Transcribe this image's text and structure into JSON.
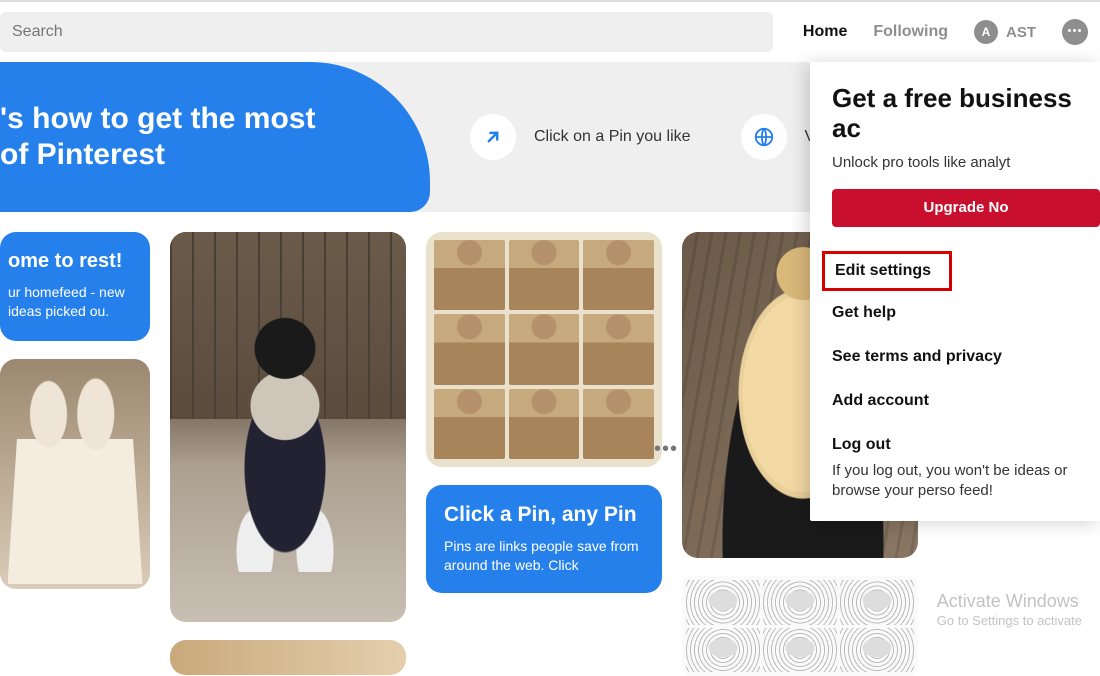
{
  "header": {
    "search_placeholder": "Search",
    "nav": {
      "home": "Home",
      "following": "Following"
    },
    "avatar_initial": "A",
    "user_name": "AST"
  },
  "hero": {
    "title_line1": "'s how to get the most",
    "title_line2": "of Pinterest",
    "tip1": "Click on a Pin you like",
    "tip2": "Visit the link it from"
  },
  "cards": {
    "welcome": {
      "title": "ome to rest!",
      "body": "ur homefeed - new ideas picked ou."
    },
    "clickpin": {
      "title": "Click a Pin, any Pin",
      "body": "Pins are links people save from around the web. Click"
    }
  },
  "dropdown": {
    "title": "Get a free business ac",
    "subtitle": "Unlock pro tools like analyt",
    "button": "Upgrade No",
    "items": {
      "edit": "Edit settings",
      "help": "Get help",
      "terms": "See terms and privacy",
      "add": "Add account",
      "logout": "Log out"
    },
    "logout_note": "If you log out, you won't be ideas or browse your perso feed!"
  },
  "watermark": {
    "line1": "Activate Windows",
    "line2": "Go to Settings to activate"
  }
}
